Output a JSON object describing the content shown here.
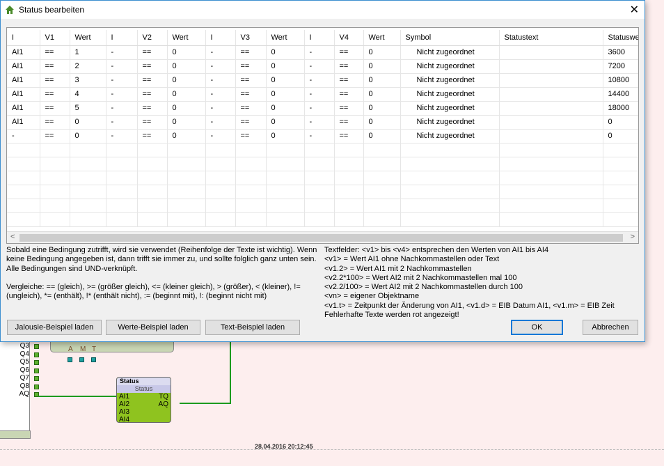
{
  "dialog": {
    "title": "Status bearbeiten",
    "close": "✕"
  },
  "table": {
    "headers": [
      "I",
      "V1",
      "Wert",
      "I",
      "V2",
      "Wert",
      "I",
      "V3",
      "Wert",
      "I",
      "V4",
      "Wert",
      "Symbol",
      "Statustext",
      "Statuswe"
    ],
    "rows": [
      [
        "AI1",
        "==",
        "1",
        "-",
        "==",
        "0",
        "-",
        "==",
        "0",
        "-",
        "==",
        "0",
        "Nicht zugeordnet",
        "",
        "3600"
      ],
      [
        "AI1",
        "==",
        "2",
        "-",
        "==",
        "0",
        "-",
        "==",
        "0",
        "-",
        "==",
        "0",
        "Nicht zugeordnet",
        "",
        "7200"
      ],
      [
        "AI1",
        "==",
        "3",
        "-",
        "==",
        "0",
        "-",
        "==",
        "0",
        "-",
        "==",
        "0",
        "Nicht zugeordnet",
        "",
        "10800"
      ],
      [
        "AI1",
        "==",
        "4",
        "-",
        "==",
        "0",
        "-",
        "==",
        "0",
        "-",
        "==",
        "0",
        "Nicht zugeordnet",
        "",
        "14400"
      ],
      [
        "AI1",
        "==",
        "5",
        "-",
        "==",
        "0",
        "-",
        "==",
        "0",
        "-",
        "==",
        "0",
        "Nicht zugeordnet",
        "",
        "18000"
      ],
      [
        "AI1",
        "==",
        "0",
        "-",
        "==",
        "0",
        "-",
        "==",
        "0",
        "-",
        "==",
        "0",
        "Nicht zugeordnet",
        "",
        "0"
      ],
      [
        "-",
        "==",
        "0",
        "-",
        "==",
        "0",
        "-",
        "==",
        "0",
        "-",
        "==",
        "0",
        "Nicht zugeordnet",
        "",
        "0"
      ]
    ]
  },
  "help_left": [
    "Sobald eine Bedingung zutrifft, wird sie verwendet (Reihenfolge der Texte ist wichtig). Wenn keine Bedingung angegeben ist, dann trifft sie immer zu, und sollte folglich ganz unten sein. Alle Bedingungen sind UND-verknüpft.",
    "Vergleiche: == (gleich), >= (größer gleich), <= (kleiner gleich), > (größer), < (kleiner), != (ungleich), *= (enthält), !* (enthält nicht), := (beginnt mit), !: (beginnt nicht mit)"
  ],
  "help_right": [
    "Textfelder: <v1> bis <v4> entsprechen den Werten von AI1 bis AI4",
    "<v1> = Wert AI1 ohne Nachkommastellen oder Text",
    "<v1.2> = Wert AI1 mit 2 Nachkommastellen",
    "<v2.2*100> = Wert AI2 mit 2 Nachkommastellen mal 100",
    "<v2.2/100> = Wert AI2 mit 2 Nachkommastellen durch 100",
    "<vn> = eigener Objektname",
    "<v1.t> = Zeitpunkt der Änderung von AI1, <v1.d> = EIB Datum AI1, <v1.m> = EIB Zeit",
    "Fehlerhafte Texte werden rot angezeigt!"
  ],
  "buttons": {
    "jalousie": "Jalousie-Beispiel laden",
    "werte": "Werte-Beispiel laden",
    "text": "Text-Beispiel laden",
    "ok": "OK",
    "cancel": "Abbrechen"
  },
  "canvas": {
    "q_labels": [
      "Q3",
      "Q4",
      "Q5",
      "Q6",
      "Q7",
      "Q8",
      "AQ"
    ],
    "amt": [
      "A",
      "M",
      "T"
    ],
    "status_block": {
      "title": "Status",
      "subtitle": "Status",
      "inputs": [
        "AI1",
        "AI2",
        "AI3",
        "AI4"
      ],
      "outputs": [
        "TQ",
        "AQ"
      ]
    },
    "timestamp": "28.04.2016 20:12:45"
  }
}
